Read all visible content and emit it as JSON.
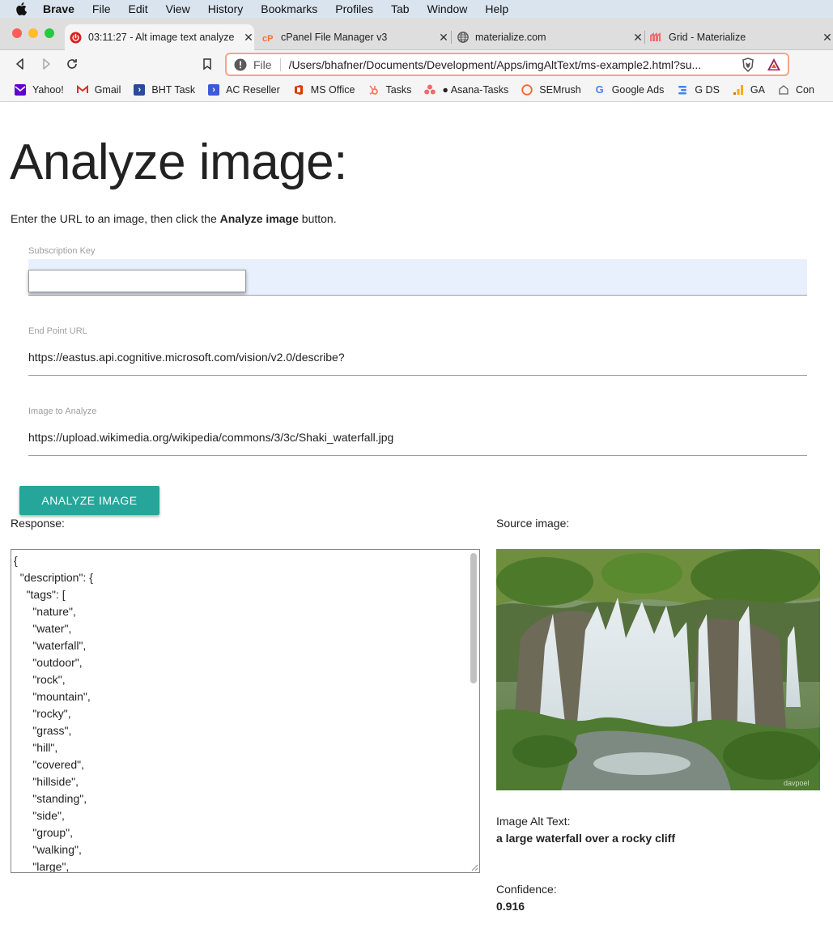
{
  "menubar": {
    "app": "Brave",
    "items": [
      "File",
      "Edit",
      "View",
      "History",
      "Bookmarks",
      "Profiles",
      "Tab",
      "Window",
      "Help"
    ]
  },
  "tabs": [
    {
      "title": "03:11:27 - Alt image text analyze",
      "icon": "power-icon",
      "active": true
    },
    {
      "title": "cPanel File Manager v3",
      "icon": "cpanel-icon",
      "active": false
    },
    {
      "title": "materialize.com",
      "icon": "globe-icon",
      "active": false
    },
    {
      "title": "Grid - Materialize",
      "icon": "materialize-icon",
      "active": false
    }
  ],
  "addressbar": {
    "scheme": "File",
    "url": "/Users/bhafner/Documents/Development/Apps/imgAltText/ms-example2.html?su..."
  },
  "bookmarks": [
    {
      "label": "Yahoo!",
      "icon": "yahoo-icon",
      "color": "#6001d2"
    },
    {
      "label": "Gmail",
      "icon": "gmail-icon",
      "color": "#d93025"
    },
    {
      "label": "BHT Task",
      "icon": "task-icon",
      "color": "#2b4a9a"
    },
    {
      "label": "AC Reseller",
      "icon": "task-icon",
      "color": "#3b5bd9"
    },
    {
      "label": "MS Office",
      "icon": "office-icon",
      "color": "#d83b01"
    },
    {
      "label": "Tasks",
      "icon": "hubspot-icon",
      "color": "#ff7a59"
    },
    {
      "label": "● Asana-Tasks",
      "icon": "asana-icon",
      "color": "#f06a6a"
    },
    {
      "label": "SEMrush",
      "icon": "semrush-icon",
      "color": "#ff642d"
    },
    {
      "label": "Google Ads",
      "icon": "google-icon",
      "color": "#4285f4"
    },
    {
      "label": "G DS",
      "icon": "datastudio-icon",
      "color": "#4285f4"
    },
    {
      "label": "GA",
      "icon": "analytics-icon",
      "color": "#f9ab00"
    },
    {
      "label": "Con",
      "icon": "generic-icon",
      "color": "#5f6368"
    }
  ],
  "page": {
    "title": "Analyze image:",
    "intro_before": "Enter the URL to an image, then click the ",
    "intro_bold": "Analyze image",
    "intro_after": " button.",
    "fields": {
      "subscription_label": "Subscription Key",
      "subscription_value": "",
      "endpoint_label": "End Point URL",
      "endpoint_value": "https://eastus.api.cognitive.microsoft.com/vision/v2.0/describe?",
      "image_label": "Image to Analyze",
      "image_value": "https://upload.wikimedia.org/wikipedia/commons/3/3c/Shaki_waterfall.jpg"
    },
    "analyze_button": "ANALYZE IMAGE",
    "response_label": "Response:",
    "source_label": "Source image:",
    "response_text": "{\n  \"description\": {\n    \"tags\": [\n      \"nature\",\n      \"water\",\n      \"waterfall\",\n      \"outdoor\",\n      \"rock\",\n      \"mountain\",\n      \"rocky\",\n      \"grass\",\n      \"hill\",\n      \"covered\",\n      \"hillside\",\n      \"standing\",\n      \"side\",\n      \"group\",\n      \"walking\",\n      \"large\",",
    "alt_label": "Image Alt Text:",
    "alt_value": "a large waterfall over a rocky cliff",
    "confidence_label": "Confidence:",
    "confidence_value": "0.916"
  },
  "colors": {
    "accent": "#26a69a",
    "autofill": "#e8f0fe"
  }
}
